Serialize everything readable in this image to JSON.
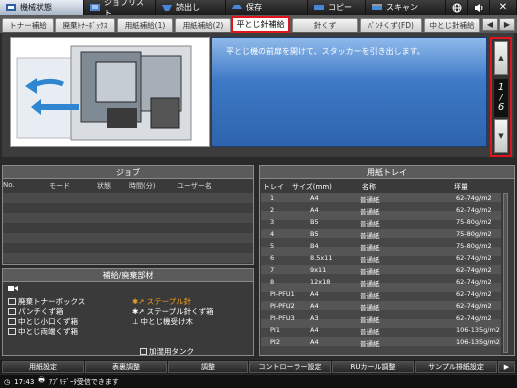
{
  "topnav": {
    "items": [
      {
        "label": "機械状態",
        "icon": "machine-status-icon",
        "active": true
      },
      {
        "label": "ジョブリスト",
        "icon": "job-list-icon",
        "active": false
      },
      {
        "label": "読出し",
        "icon": "recall-icon",
        "active": false
      },
      {
        "label": "保存",
        "icon": "save-icon",
        "active": false
      },
      {
        "label": "コピー",
        "icon": "copy-icon",
        "active": false
      },
      {
        "label": "スキャン",
        "icon": "scan-icon",
        "active": false
      }
    ],
    "globe_icon": "globe-icon",
    "volume_icon": "speaker-icon",
    "close_icon": "close-icon"
  },
  "tabs": {
    "left_arrow": "◀",
    "right_arrow": "▶",
    "items": [
      {
        "label": "トナー補給"
      },
      {
        "label": "廃棄ﾄﾅｰﾎﾞｯｸｽ"
      },
      {
        "label": "用紙補給(1)"
      },
      {
        "label": "用紙補給(2)"
      },
      {
        "label": "平とじ針補給",
        "active": true
      },
      {
        "label": "針くず"
      },
      {
        "label": "ﾊﾟﾝﾁくず(FD)"
      },
      {
        "label": "中とじ針補給"
      }
    ]
  },
  "guide": {
    "message": "平とじ機の前扉を開けて、スタッカーを引き出します。",
    "page_current": "1",
    "page_total": "6",
    "up": "▲",
    "down": "▼"
  },
  "job": {
    "title": "ジョブ",
    "columns": [
      "No.",
      "モード",
      "状態",
      "時間(分)",
      "ユーザー名"
    ]
  },
  "tray": {
    "title": "用紙トレイ",
    "columns": [
      "トレイ",
      "サイズ(mm)",
      "名称",
      "坪量"
    ],
    "rows": [
      {
        "tray": "1",
        "size": "A4",
        "name": "普通紙",
        "weight": "62-74g/m2"
      },
      {
        "tray": "2",
        "size": "A4",
        "name": "普通紙",
        "weight": "62-74g/m2"
      },
      {
        "tray": "3",
        "size": "B5",
        "name": "普通紙",
        "weight": "75-80g/m2"
      },
      {
        "tray": "4",
        "size": "B5",
        "name": "普通紙",
        "weight": "75-80g/m2"
      },
      {
        "tray": "5",
        "size": "B4",
        "name": "普通紙",
        "weight": "75-80g/m2"
      },
      {
        "tray": "6",
        "size": "8.5x11",
        "name": "普通紙",
        "weight": "62-74g/m2"
      },
      {
        "tray": "7",
        "size": "9x11",
        "name": "普通紙",
        "weight": "62-74g/m2"
      },
      {
        "tray": "8",
        "size": "12x18",
        "name": "普通紙",
        "weight": "62-74g/m2"
      },
      {
        "tray": "PI-PFU1",
        "size": "A4",
        "name": "普通紙",
        "weight": "62-74g/m2"
      },
      {
        "tray": "PI-PFU2",
        "size": "A4",
        "name": "普通紙",
        "weight": "62-74g/m2"
      },
      {
        "tray": "PI-PFU3",
        "size": "A3",
        "name": "普通紙",
        "weight": "62-74g/m2"
      },
      {
        "tray": "PI1",
        "size": "A4",
        "name": "普通紙",
        "weight": "106-135g/m2"
      },
      {
        "tray": "PI2",
        "size": "A4",
        "name": "普通紙",
        "weight": "106-135g/m2"
      }
    ]
  },
  "supplies": {
    "title": "補給/廃棄部材",
    "left": [
      {
        "label": "廃棄トナーボックス",
        "icon": "waste-toner-icon"
      },
      {
        "label": "パンチくず箱",
        "icon": "punch-waste-icon"
      },
      {
        "label": "中とじ小口くず箱",
        "icon": "trim-waste-icon"
      },
      {
        "label": "中とじ両端くず箱",
        "icon": "trim-waste-icon"
      }
    ],
    "right": [
      {
        "label": "ステープル針",
        "icon": "staple-icon",
        "warn": true
      },
      {
        "label": "ステープル針くず箱",
        "icon": "staple-waste-icon",
        "warn": false
      },
      {
        "label": "中とじ機受け木",
        "icon": "saddle-anvil-icon",
        "warn": false
      }
    ],
    "tank": {
      "label": "加湿用タンク",
      "icon": "water-tank-icon"
    }
  },
  "bottom": {
    "buttons": [
      "用紙設定",
      "表裏調整",
      "調整",
      "コントローラー設定",
      "RUカール調整",
      "サンプル排紙設定"
    ],
    "next": "▶"
  },
  "status": {
    "time": "17:43",
    "message": "ｱﾌﾟﾘﾃﾞｰﾀ受信できます"
  }
}
